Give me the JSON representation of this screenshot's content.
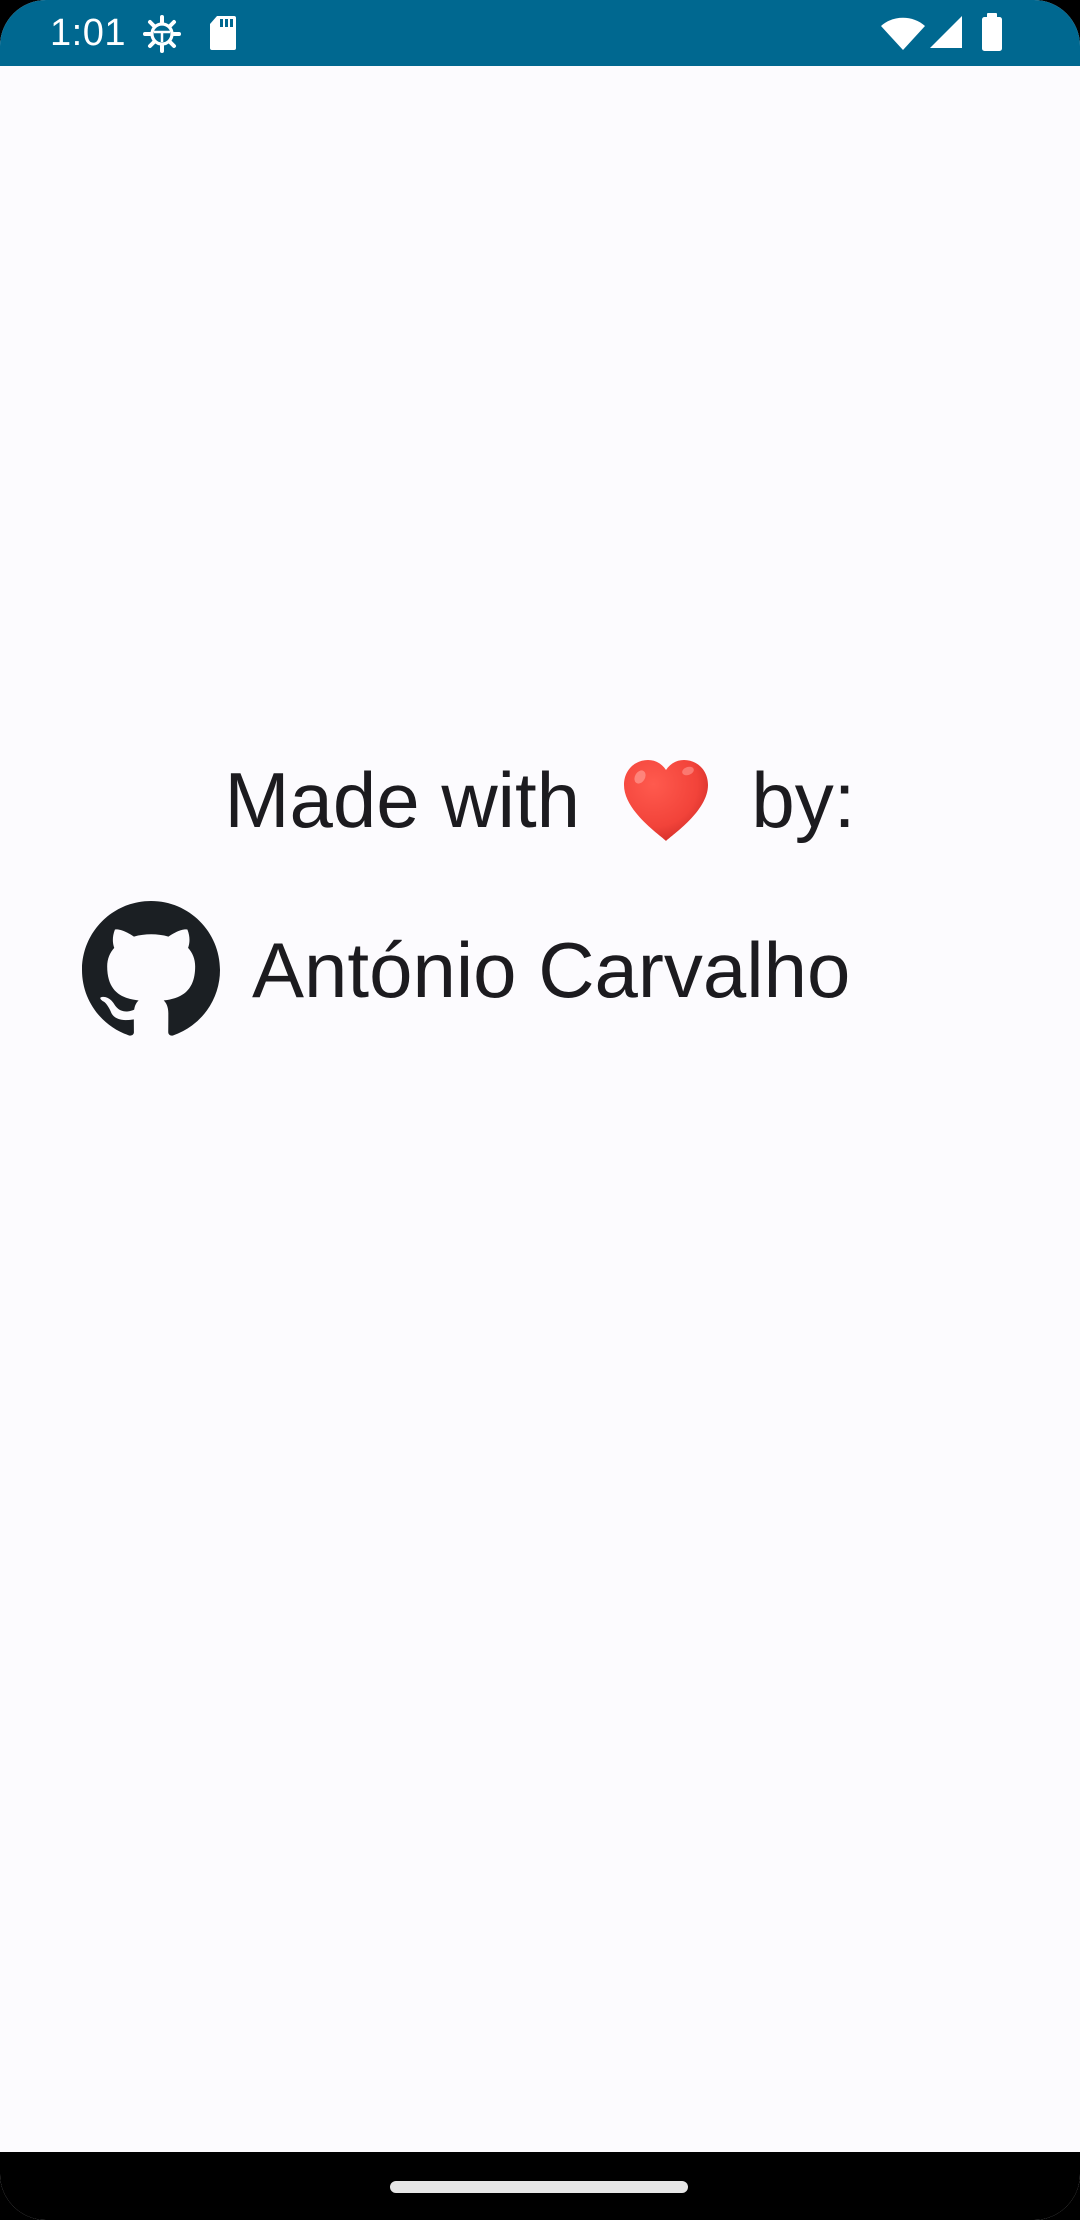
{
  "status_bar": {
    "time": "1:01",
    "icons": [
      "gear-icon",
      "sd-card-icon",
      "wifi-icon",
      "signal-icon",
      "battery-icon"
    ],
    "background_color": "#006890"
  },
  "credits": {
    "prefix": "Made with",
    "suffix": "by:",
    "heart_icon": "red-heart-emoji",
    "author_icon": "github-icon",
    "author_name": "António Carvalho"
  },
  "colors": {
    "background": "#FCFBFE",
    "text": "#1C1B1F",
    "heart": "#F2433A"
  }
}
